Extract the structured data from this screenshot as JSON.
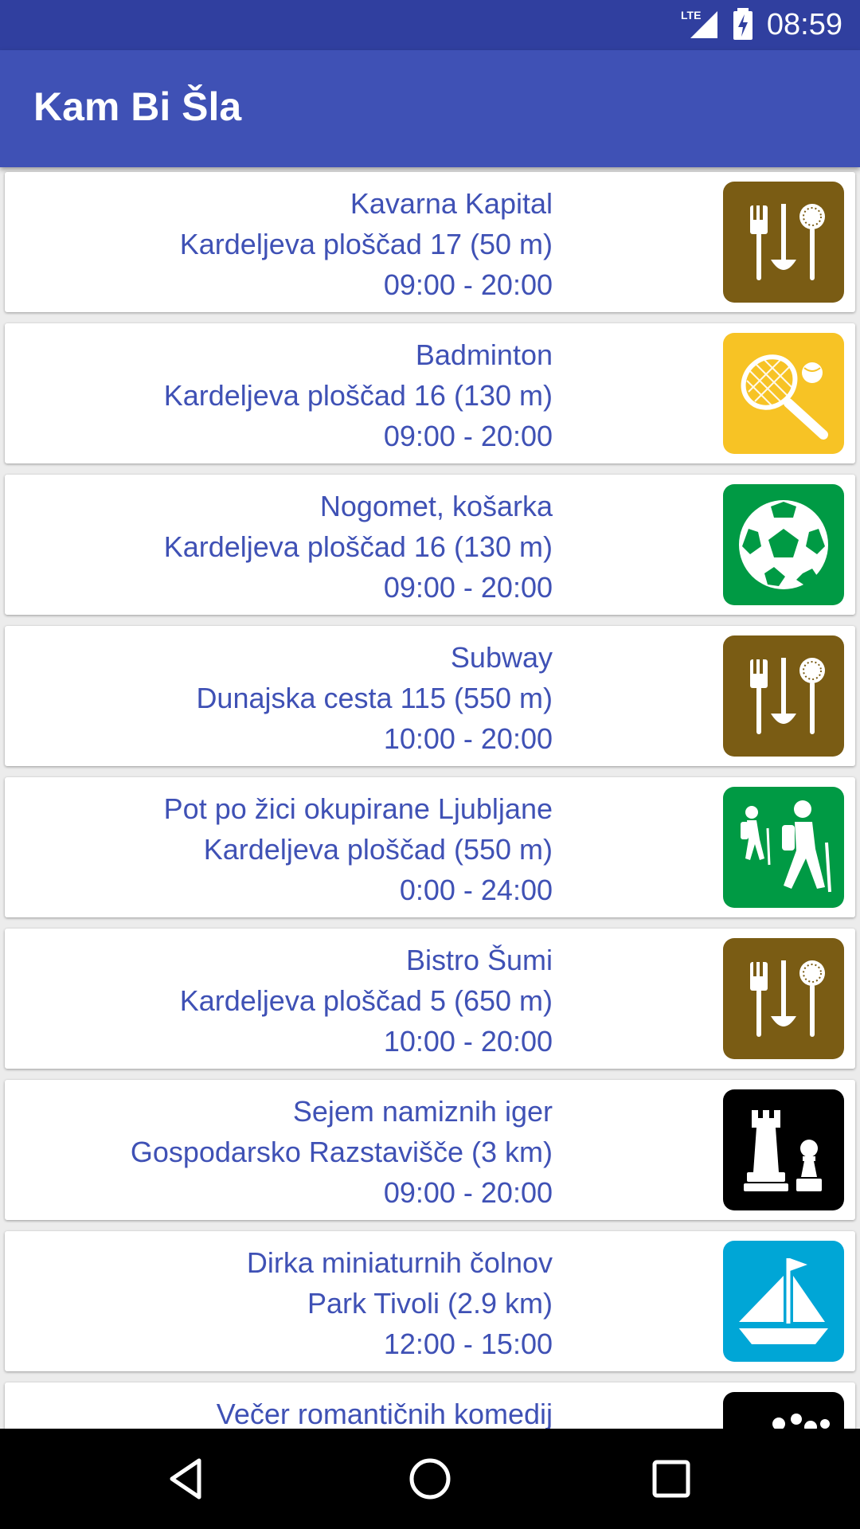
{
  "status_bar": {
    "network": "LTE",
    "time": "08:59"
  },
  "app_bar": {
    "title": "Kam Bi Šla"
  },
  "items": [
    {
      "name": "Kavarna Kapital",
      "address": "Kardeljeva ploščad 17 (50 m)",
      "hours": "09:00 - 20:00",
      "icon": "food-utensils-icon",
      "icon_color": "#7a5c14"
    },
    {
      "name": "Badminton",
      "address": "Kardeljeva ploščad 16 (130 m)",
      "hours": "09:00 - 20:00",
      "icon": "racket-icon",
      "icon_color": "#f7c325"
    },
    {
      "name": "Nogomet, košarka",
      "address": "Kardeljeva ploščad 16 (130 m)",
      "hours": "09:00 - 20:00",
      "icon": "soccer-ball-icon",
      "icon_color": "#009a44"
    },
    {
      "name": "Subway",
      "address": "Dunajska cesta 115 (550 m)",
      "hours": "10:00 - 20:00",
      "icon": "food-utensils-icon",
      "icon_color": "#7a5c14"
    },
    {
      "name": "Pot po žici okupirane Ljubljane",
      "address": "Kardeljeva ploščad (550 m)",
      "hours": "0:00 - 24:00",
      "icon": "hikers-icon",
      "icon_color": "#009a44"
    },
    {
      "name": "Bistro Šumi",
      "address": "Kardeljeva ploščad 5 (650 m)",
      "hours": "10:00 - 20:00",
      "icon": "food-utensils-icon",
      "icon_color": "#7a5c14"
    },
    {
      "name": "Sejem namiznih iger",
      "address": "Gospodarsko Razstavišče (3 km)",
      "hours": "09:00 - 20:00",
      "icon": "chess-pieces-icon",
      "icon_color": "#000000"
    },
    {
      "name": "Dirka miniaturnih čolnov",
      "address": "Park Tivoli (2.9 km)",
      "hours": "12:00 - 15:00",
      "icon": "sailboat-icon",
      "icon_color": "#00a6d6"
    },
    {
      "name": "Večer romantičnih komedij",
      "address": "",
      "hours": "",
      "icon": "movie-icon",
      "icon_color": "#000000"
    }
  ],
  "nav_bar": {
    "buttons": [
      "back-icon",
      "home-icon",
      "recents-icon"
    ]
  }
}
